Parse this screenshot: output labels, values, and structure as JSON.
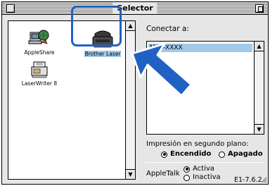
{
  "window": {
    "title": "Selector"
  },
  "icons": [
    {
      "label": "AppleShare"
    },
    {
      "label": "Brother Laser"
    },
    {
      "label": "LaserWriter 8"
    }
  ],
  "connect": {
    "label": "Conectar a:",
    "selected_item": "MFC-XXXX"
  },
  "background_printing": {
    "label": "Impresión en segundo plano:",
    "on_label": "Encendido",
    "off_label": "Apagado",
    "selected": "Encendido"
  },
  "appletalk": {
    "label": "AppleTalk",
    "active_label": "Activa",
    "inactive_label": "Inactiva",
    "selected": "Activa"
  },
  "version": "E1-7.6.2",
  "colors": {
    "selection": "#a3c9e8",
    "highlight_frame": "#1f62c4",
    "arrow": "#1f62c4"
  }
}
